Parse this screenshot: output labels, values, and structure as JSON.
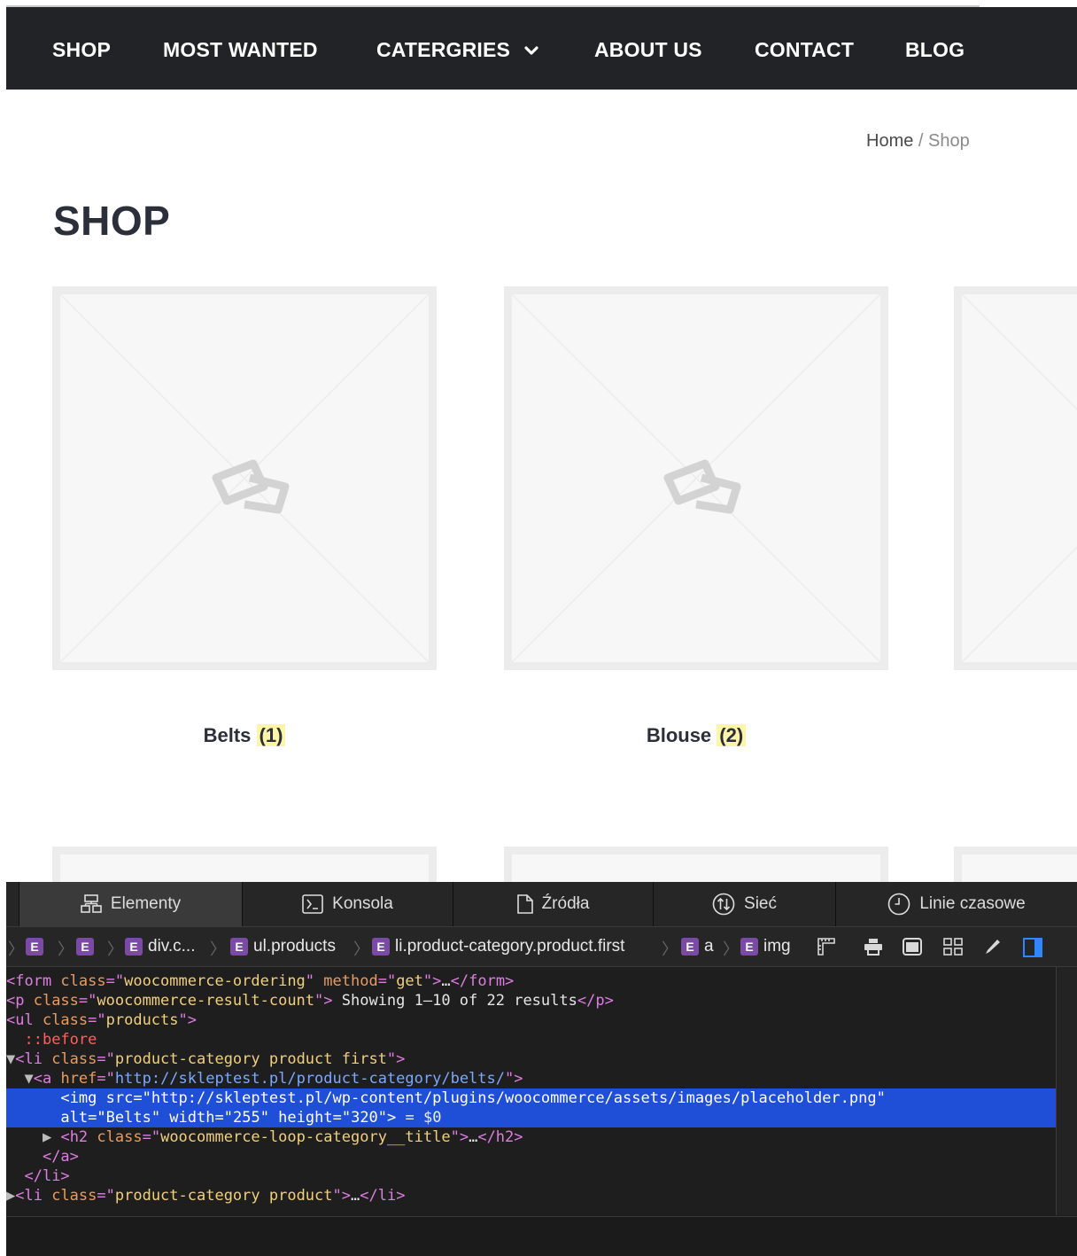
{
  "nav": {
    "items": [
      "SHOP",
      "MOST WANTED",
      "CATERGRIES",
      "ABOUT US",
      "CONTACT",
      "BLOG"
    ],
    "background": "#222326",
    "dropdown_icon": "chevron-down-icon"
  },
  "breadcrumb": {
    "home": "Home",
    "separator": "/",
    "current": "Shop"
  },
  "page": {
    "title": "SHOP"
  },
  "products": [
    {
      "name": "Belts",
      "count": "(1)"
    },
    {
      "name": "Blouse",
      "count": "(2)"
    }
  ],
  "devtools": {
    "tabs": [
      {
        "label": "Elementy",
        "icon": "elements-icon"
      },
      {
        "label": "Konsola",
        "icon": "console-icon"
      },
      {
        "label": "Źródła",
        "icon": "document-icon"
      },
      {
        "label": "Sieć",
        "icon": "network-icon"
      },
      {
        "label": "Linie czasowe",
        "icon": "clock-icon"
      }
    ],
    "crumbs": [
      {
        "badge": "E",
        "label": ""
      },
      {
        "badge": "E",
        "label": ""
      },
      {
        "badge": "E",
        "label": "div.c..."
      },
      {
        "badge": "E",
        "label": "ul.products"
      },
      {
        "badge": "E",
        "label": "li.product-category.product.first"
      },
      {
        "badge": "E",
        "label": "a"
      },
      {
        "badge": "E",
        "label": "img"
      }
    ],
    "dom": {
      "form_class": "woocommerce-ordering",
      "form_method": "get",
      "p_class": "woocommerce-result-count",
      "result_text": " Showing 1–10 of 22 results",
      "ul_class": "products",
      "pseudo": "::before",
      "li_first_class": "product-category product first",
      "a_href": "http://skleptest.pl/product-category/belts/",
      "img_src": "http://skleptest.pl/wp-content/plugins/woocommerce/assets/images/placeholder.png",
      "img_alt": "Belts",
      "img_width": "255",
      "img_height": "320",
      "sel_marker": " = $0",
      "h2_class": "woocommerce-loop-category__title",
      "li_class": "product-category product",
      "ellipsis": "…"
    },
    "selection_color": "#1f4fd6"
  }
}
